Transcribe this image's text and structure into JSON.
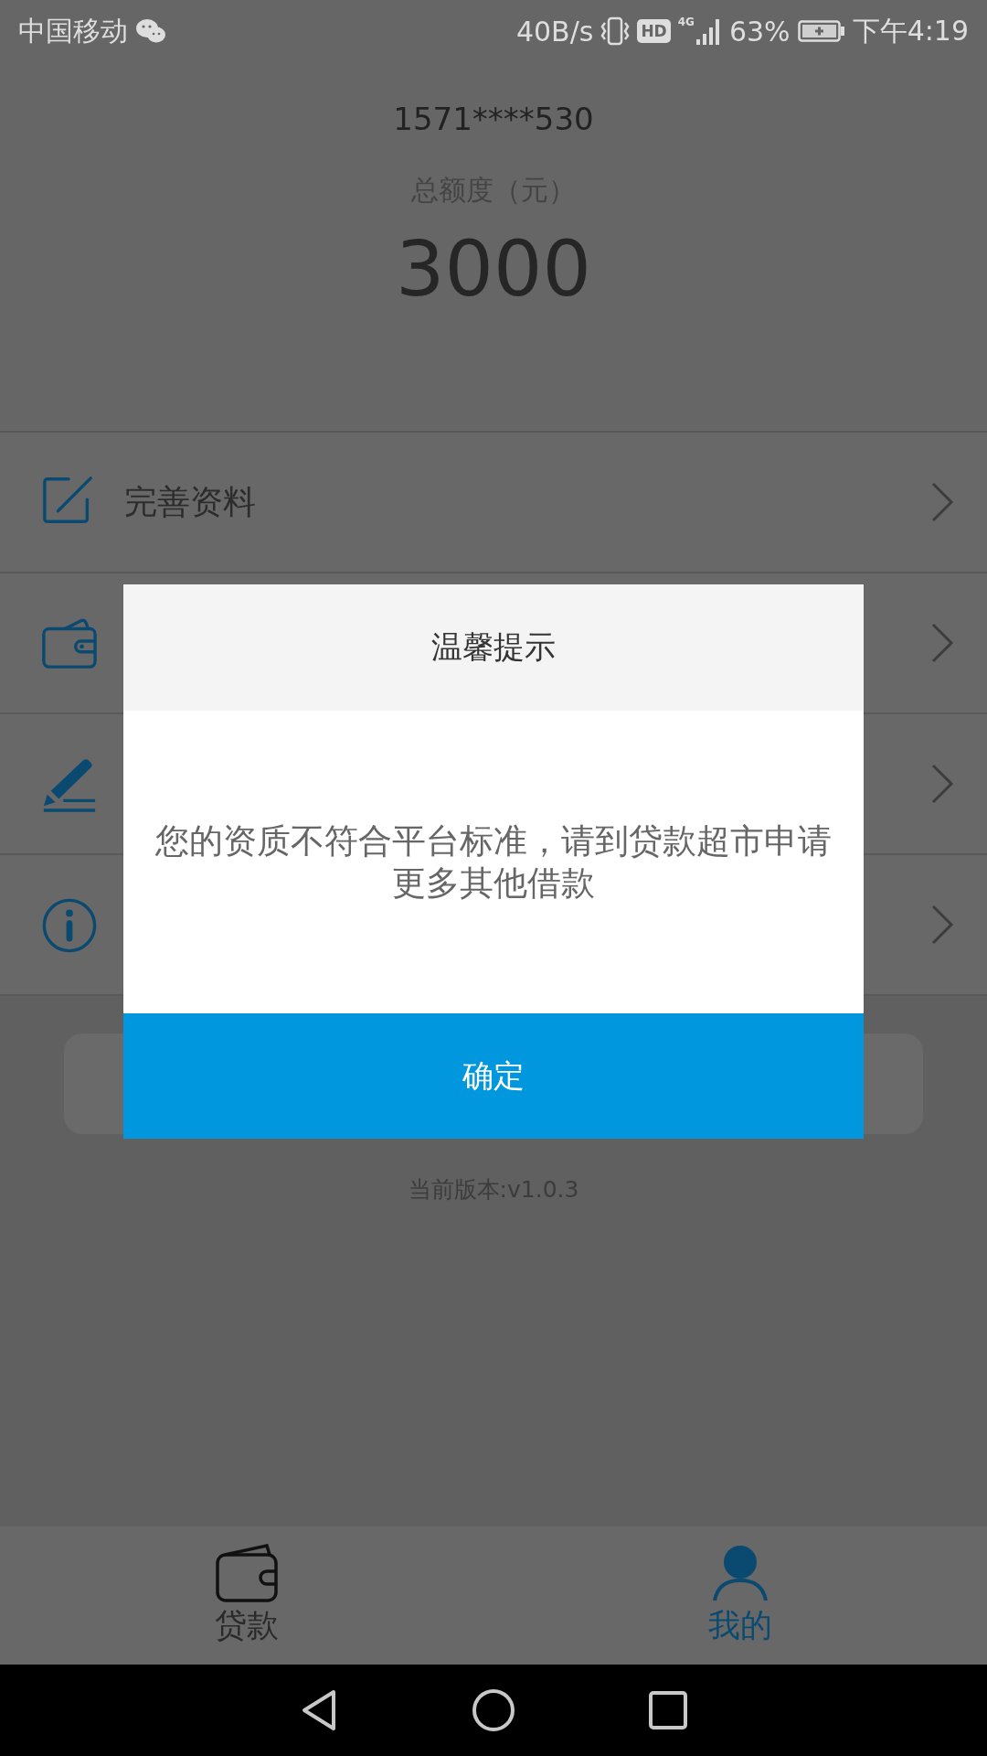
{
  "status_bar": {
    "carrier": "中国移动",
    "speed": "40B/s",
    "hd": "HD",
    "network": "4G",
    "battery": "63%",
    "time": "下午4:19"
  },
  "account": {
    "phone": "1571****530",
    "limit_label": "总额度（元）",
    "limit_amount": "3000"
  },
  "menu": [
    {
      "kind": "edit",
      "label": "完善资料"
    },
    {
      "kind": "wallet"
    },
    {
      "kind": "sign"
    },
    {
      "kind": "info"
    }
  ],
  "version": "当前版本:v1.0.3",
  "dialog": {
    "title": "温馨提示",
    "message": "您的资质不符合平台标准，请到贷款超市申请更多其他借款",
    "button": "确定"
  },
  "tabs": [
    {
      "kind": "wallet",
      "label": "贷款",
      "selected": false
    },
    {
      "kind": "person",
      "label": "我的",
      "selected": true
    }
  ]
}
